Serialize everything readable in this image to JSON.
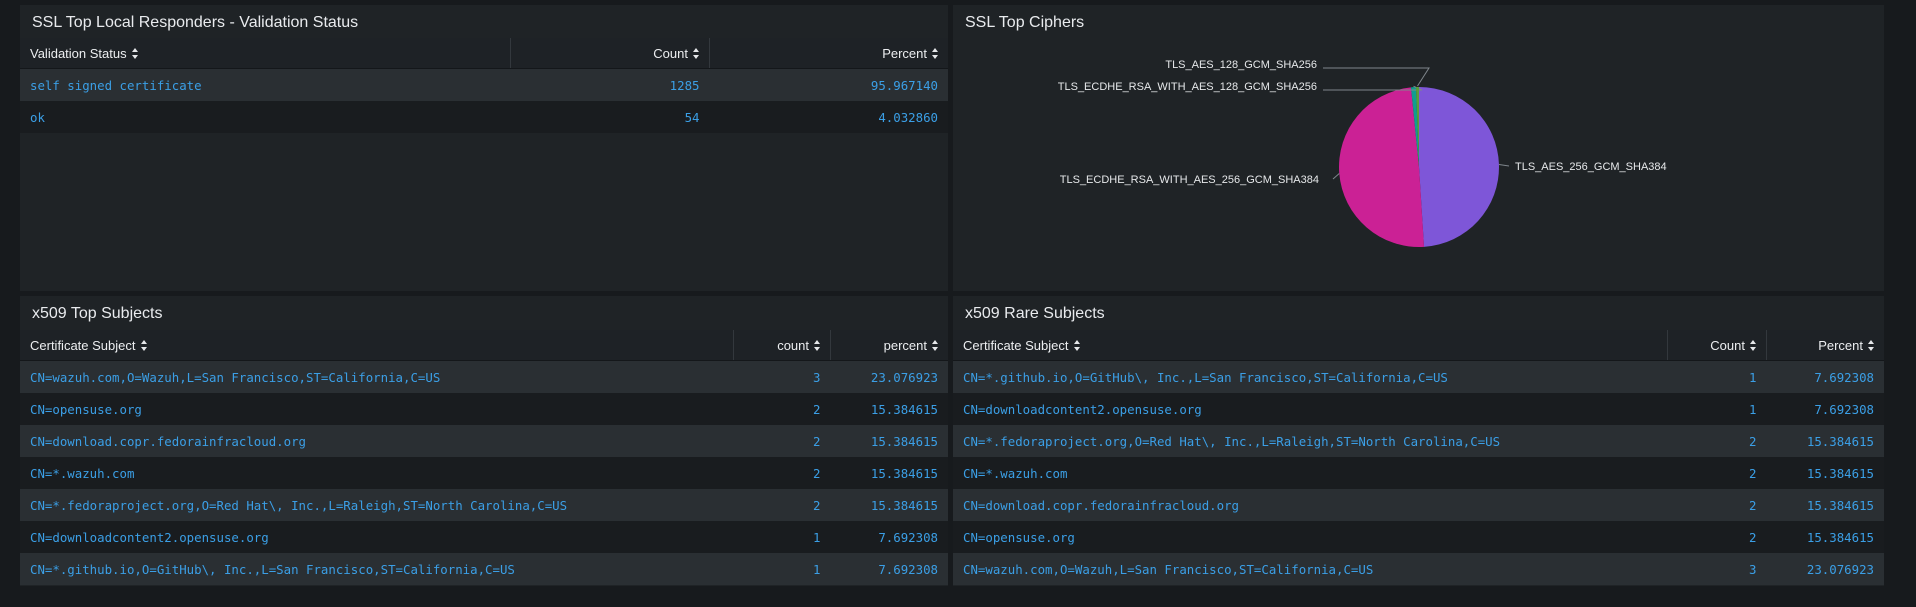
{
  "panels": {
    "responders": {
      "title": "SSL Top Local Responders - Validation Status",
      "columns": [
        "Validation Status",
        "Count",
        "Percent"
      ],
      "rows": [
        [
          "self signed certificate",
          "1285",
          "95.967140"
        ],
        [
          "ok",
          "54",
          "4.032860"
        ]
      ]
    },
    "ciphers": {
      "title": "SSL Top Ciphers"
    },
    "top_subjects": {
      "title": "x509 Top Subjects",
      "columns": [
        "Certificate Subject",
        "count",
        "percent"
      ],
      "rows": [
        [
          "CN=wazuh.com,O=Wazuh,L=San Francisco,ST=California,C=US",
          "3",
          "23.076923"
        ],
        [
          "CN=opensuse.org",
          "2",
          "15.384615"
        ],
        [
          "CN=download.copr.fedorainfracloud.org",
          "2",
          "15.384615"
        ],
        [
          "CN=*.wazuh.com",
          "2",
          "15.384615"
        ],
        [
          "CN=*.fedoraproject.org,O=Red Hat\\, Inc.,L=Raleigh,ST=North Carolina,C=US",
          "2",
          "15.384615"
        ],
        [
          "CN=downloadcontent2.opensuse.org",
          "1",
          "7.692308"
        ],
        [
          "CN=*.github.io,O=GitHub\\, Inc.,L=San Francisco,ST=California,C=US",
          "1",
          "7.692308"
        ]
      ]
    },
    "rare_subjects": {
      "title": "x509 Rare Subjects",
      "columns": [
        "Certificate Subject",
        "Count",
        "Percent"
      ],
      "rows": [
        [
          "CN=*.github.io,O=GitHub\\, Inc.,L=San Francisco,ST=California,C=US",
          "1",
          "7.692308"
        ],
        [
          "CN=downloadcontent2.opensuse.org",
          "1",
          "7.692308"
        ],
        [
          "CN=*.fedoraproject.org,O=Red Hat\\, Inc.,L=Raleigh,ST=North Carolina,C=US",
          "2",
          "15.384615"
        ],
        [
          "CN=*.wazuh.com",
          "2",
          "15.384615"
        ],
        [
          "CN=download.copr.fedorainfracloud.org",
          "2",
          "15.384615"
        ],
        [
          "CN=opensuse.org",
          "2",
          "15.384615"
        ],
        [
          "CN=wazuh.com,O=Wazuh,L=San Francisco,ST=California,C=US",
          "3",
          "23.076923"
        ]
      ]
    }
  },
  "chart_data": {
    "type": "pie",
    "slices": [
      {
        "label": "TLS_AES_256_GCM_SHA384",
        "value": 49,
        "color": "#7e56d8"
      },
      {
        "label": "TLS_ECDHE_RSA_WITH_AES_256_GCM_SHA384",
        "value": 49.4,
        "color": "#cb2195"
      },
      {
        "label": "TLS_ECDHE_RSA_WITH_AES_128_GCM_SHA256",
        "value": 1.0,
        "color": "#0f9e8f"
      },
      {
        "label": "TLS_AES_128_GCM_SHA256",
        "value": 0.6,
        "color": "#5a9e3a"
      }
    ]
  },
  "colors": {
    "link": "#3b9fe6",
    "page_bg": "#171a1d",
    "panel_bg": "#1f2326",
    "row_odd": "#2a2f33",
    "row_even": "#191c1f"
  },
  "icons": {
    "sort": "sort-icon"
  }
}
